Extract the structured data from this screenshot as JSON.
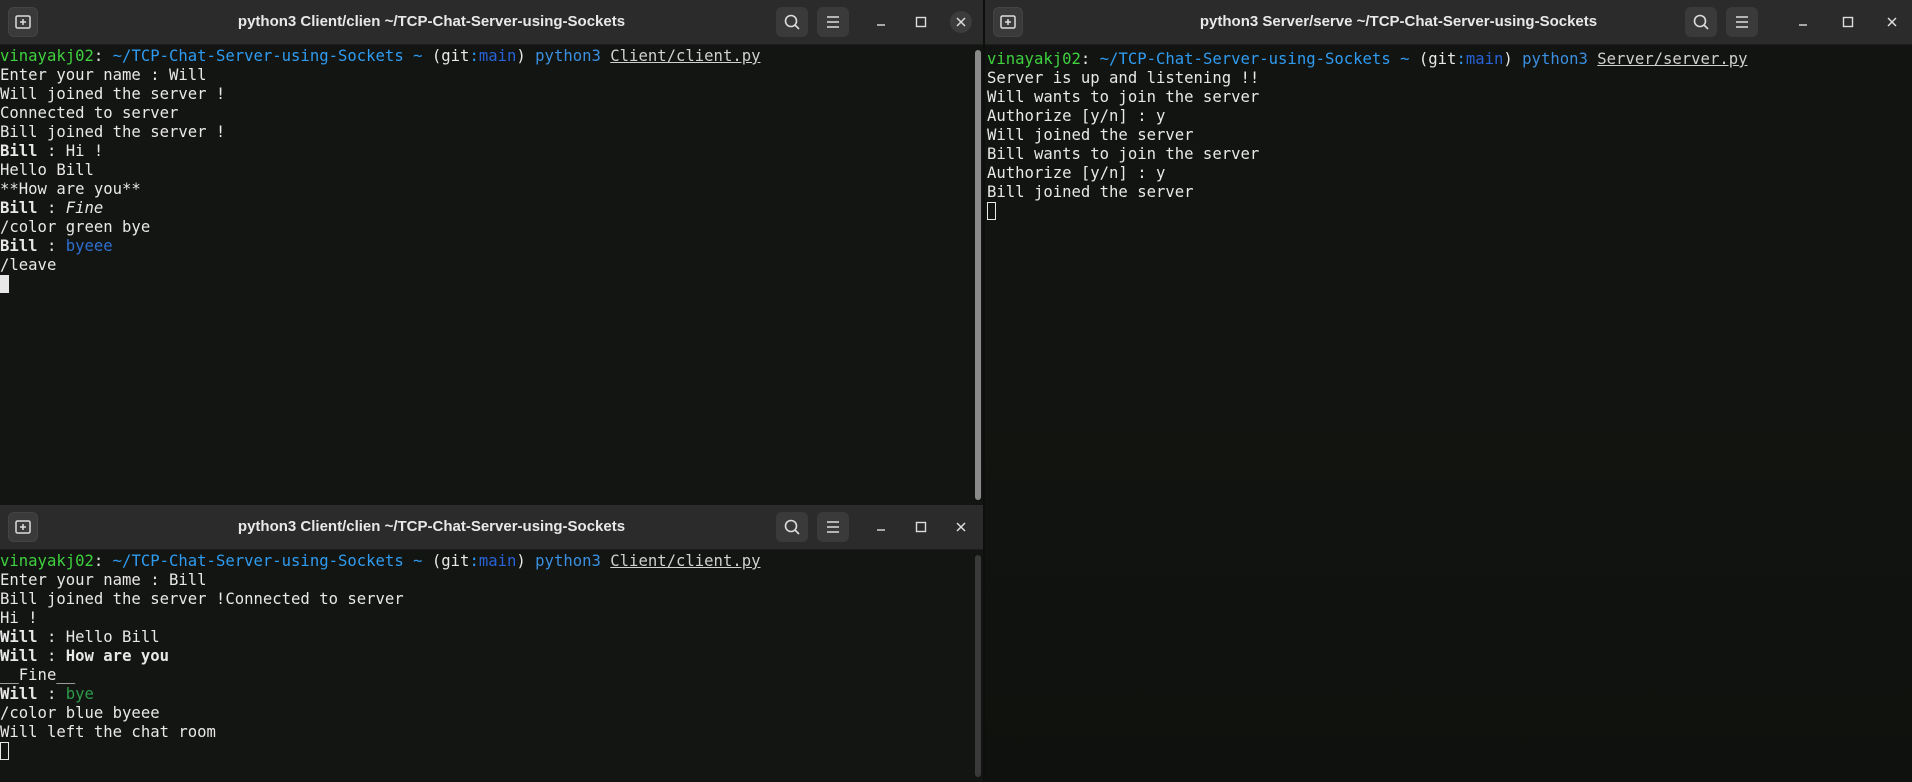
{
  "colors": {
    "user": "#3fd13f",
    "path": "#2f9bf0",
    "git_branch": "#2763d6",
    "msg_blue": "#2f6fd0",
    "msg_green": "#2e9a4a"
  },
  "windows": {
    "client_top": {
      "title": "python3 Client/clien ~/TCP-Chat-Server-using-Sockets",
      "prompt": {
        "user": "vinayakj02",
        "colon": ":",
        "path": " ~/TCP-Chat-Server-using-Sockets ~ ",
        "git_open": "(git",
        "git_sep": ":",
        "branch": "main",
        "git_close": ")",
        "cmd": " python3 ",
        "file": "Client/client.py"
      },
      "lines": {
        "l1": "Enter your name : Will",
        "l2": "Will joined the server !",
        "l3": "Connected to server",
        "l4": "Bill joined the server !",
        "l5_name": "Bill",
        "l5_text": " : Hi !",
        "l6": "Hello Bill",
        "l7": "**How are you**",
        "l8_name": "Bill",
        "l8_sep": " : ",
        "l8_text": "Fine",
        "l9": "/color green bye",
        "l10_name": "Bill",
        "l10_sep": " : ",
        "l10_text": "byeee",
        "l11": "/leave"
      }
    },
    "client_bottom": {
      "title": "python3 Client/clien ~/TCP-Chat-Server-using-Sockets",
      "prompt": {
        "user": "vinayakj02",
        "colon": ":",
        "path": " ~/TCP-Chat-Server-using-Sockets ~ ",
        "git_open": "(git",
        "git_sep": ":",
        "branch": "main",
        "git_close": ")",
        "cmd": " python3 ",
        "file": "Client/client.py"
      },
      "lines": {
        "l1": "Enter your name : Bill",
        "l2": "Bill joined the server !Connected to server",
        "l3": "Hi !",
        "l4_name": "Will",
        "l4_text": " : Hello Bill",
        "l5_name": "Will",
        "l5_sep": " : ",
        "l5_text": "How are you",
        "l6": "__Fine__",
        "l7_name": "Will",
        "l7_sep": " : ",
        "l7_text": "bye",
        "l8": "/color blue byeee",
        "l9": "Will left the chat room"
      }
    },
    "server": {
      "title": "python3 Server/serve ~/TCP-Chat-Server-using-Sockets",
      "prompt": {
        "user": "vinayakj02",
        "colon": ":",
        "path": " ~/TCP-Chat-Server-using-Sockets ~ ",
        "git_open": "(git",
        "git_sep": ":",
        "branch": "main",
        "git_close": ")",
        "cmd": " python3 ",
        "file": "Server/server.py"
      },
      "lines": {
        "l1": "Server is up and listening !!",
        "l2": "Will wants to join the server",
        "l3": "Authorize [y/n] : y",
        "l4": "Will joined the server",
        "l5": "Bill wants to join the server",
        "l6": "Authorize [y/n] : y",
        "l7": "Bill joined the server"
      }
    }
  },
  "icons": {
    "new_tab": "new-tab-icon",
    "search": "search-icon",
    "menu": "hamburger-menu-icon",
    "minimize": "minimize-icon",
    "maximize": "maximize-icon",
    "close": "close-icon"
  }
}
